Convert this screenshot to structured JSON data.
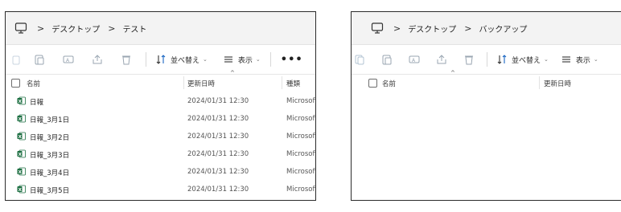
{
  "left_window": {
    "breadcrumb": [
      "デスクトップ",
      "テスト"
    ],
    "toolbar": {
      "sort_label": "並べ替え",
      "view_label": "表示",
      "more_label": "•••"
    },
    "columns": {
      "name": "名前",
      "modified": "更新日時",
      "type": "種類"
    },
    "files": [
      {
        "name": "日報",
        "modified": "2024/01/31 12:30",
        "type": "Microsoft"
      },
      {
        "name": "日報_3月1日",
        "modified": "2024/01/31 12:30",
        "type": "Microsoft"
      },
      {
        "name": "日報_3月2日",
        "modified": "2024/01/31 12:30",
        "type": "Microsoft"
      },
      {
        "name": "日報_3月3日",
        "modified": "2024/01/31 12:30",
        "type": "Microsoft"
      },
      {
        "name": "日報_3月4日",
        "modified": "2024/01/31 12:30",
        "type": "Microsoft"
      },
      {
        "name": "日報_3月5日",
        "modified": "2024/01/31 12:30",
        "type": "Microsoft"
      }
    ]
  },
  "right_window": {
    "breadcrumb": [
      "デスクトップ",
      "バックアップ"
    ],
    "toolbar": {
      "sort_label": "並べ替え",
      "view_label": "表示"
    },
    "columns": {
      "name": "名前",
      "modified": "更新日時"
    }
  },
  "icons": {
    "pc": "this-pc-icon",
    "copy": "copy-icon",
    "paste": "paste-icon",
    "rename": "rename-icon",
    "share": "share-icon",
    "delete": "delete-icon",
    "sort": "sort-icon",
    "view": "view-icon",
    "file": "excel-file-icon"
  },
  "colors": {
    "excel_green": "#1d6f42",
    "address_bg": "#f3f3f3",
    "border": "#2b2b2b"
  }
}
